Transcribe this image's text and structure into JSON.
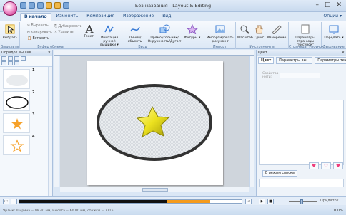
{
  "window": {
    "title": "Без названия - Layout & Editing",
    "min": "–",
    "max": "□",
    "close": "✕"
  },
  "tabs": [
    "В начало",
    "Изменить",
    "Композиция",
    "Изображение",
    "Вид"
  ],
  "options_label": "Опции ▾",
  "ribbon": {
    "clipboard": {
      "select": "Выбрать",
      "cut": "Вырезать",
      "copy": "Копировать",
      "duplicate": "Дублировать",
      "delete": "Удалить",
      "paste": "Вставить",
      "group_label": "Буфер обмена",
      "select_group": "Выделить"
    },
    "input": {
      "text": "Текст",
      "manual": "Имитация ручной вышивки ▾",
      "line": "Линия/объекты",
      "shapes": "Прямоугольник/ Окружность/Дуга ▾",
      "figures": "Фигуры ▾",
      "group_label": "Ввод"
    },
    "import": {
      "label": "Импортировать рисунок ▾",
      "group_label": "Импорт"
    },
    "tools": {
      "zoom": "Масштаб",
      "move": "Сдвиг",
      "measure": "Измерение",
      "group_label": "Инструменты"
    },
    "page_pattern": {
      "label": "Параметры страницы \"Рисунок\"",
      "group_label": "Страница \"Рисунок\""
    },
    "transfer": {
      "label": "Передать ▾",
      "group_label": "Вышивание"
    }
  },
  "left_panel": {
    "title": "Порядок вышив...",
    "items": [
      {
        "num": "1"
      },
      {
        "num": "2"
      },
      {
        "num": "3"
      },
      {
        "num": "4"
      }
    ]
  },
  "right_panel": {
    "title": "Цвет",
    "tabs": [
      "Цвет",
      "Параметры вы...",
      "Параметры текс..."
    ],
    "property_label": "Свойства нити:",
    "set_button": "В режим списка"
  },
  "status": {
    "text": "Ярлык: Ширина = 99.40 мм, Высота = 60.00 мм, стежки = 7715",
    "zoom": "100%"
  },
  "player": {
    "fit_label": "Придаток",
    "progress": 0.86
  }
}
